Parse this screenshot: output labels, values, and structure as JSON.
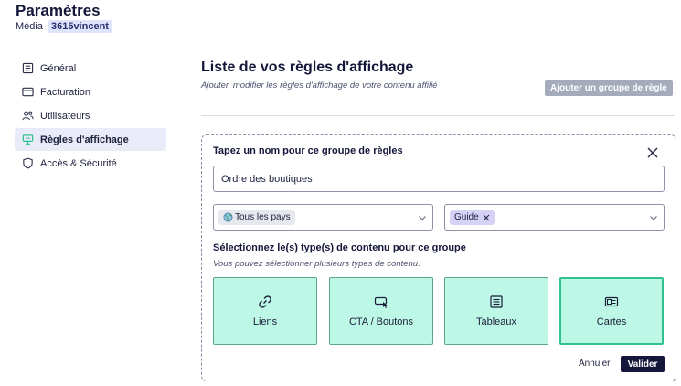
{
  "header": {
    "title": "Paramètres",
    "media_label": "Média",
    "media_name": "3615vincent"
  },
  "sidebar": {
    "items": [
      {
        "label": "Général",
        "icon": "general-icon",
        "active": false
      },
      {
        "label": "Facturation",
        "icon": "credit-card-icon",
        "active": false
      },
      {
        "label": "Utilisateurs",
        "icon": "users-icon",
        "active": false
      },
      {
        "label": "Règles d'affichage",
        "icon": "display-rules-icon",
        "active": true
      },
      {
        "label": "Accès & Sécurité",
        "icon": "shield-icon",
        "active": false
      }
    ]
  },
  "main": {
    "title": "Liste de vos règles d'affichage",
    "subtitle": "Ajouter, modifier les règles d'affichage de votre contenu affilié",
    "add_group_label": "Ajouter un groupe de règle"
  },
  "group": {
    "name_label": "Tapez un nom pour ce groupe de règles",
    "name_value": "Ordre des boutiques",
    "country_tag": "Tous les pays",
    "guide_tag": "Guide",
    "type_label": "Sélectionnez le(s) type(s) de contenu pour ce groupe",
    "type_sub": "Vous pouvez sélectionner plusieurs types de contenu.",
    "types": [
      {
        "label": "Liens",
        "icon": "link-icon",
        "selected": false
      },
      {
        "label": "CTA / Boutons",
        "icon": "cta-button-icon",
        "selected": false
      },
      {
        "label": "Tableaux",
        "icon": "table-icon",
        "selected": false
      },
      {
        "label": "Cartes",
        "icon": "card-icon",
        "selected": true
      }
    ],
    "cancel_label": "Annuler",
    "validate_label": "Valider"
  },
  "colors": {
    "accent_dark": "#14173a",
    "type_card_bg": "#bdf7e6",
    "type_card_selected_border": "#2fc28e",
    "guide_tag_bg": "#d6d2f5",
    "sidebar_active_bg": "#e9ebf9",
    "disabled_button": "#a6abbb"
  }
}
